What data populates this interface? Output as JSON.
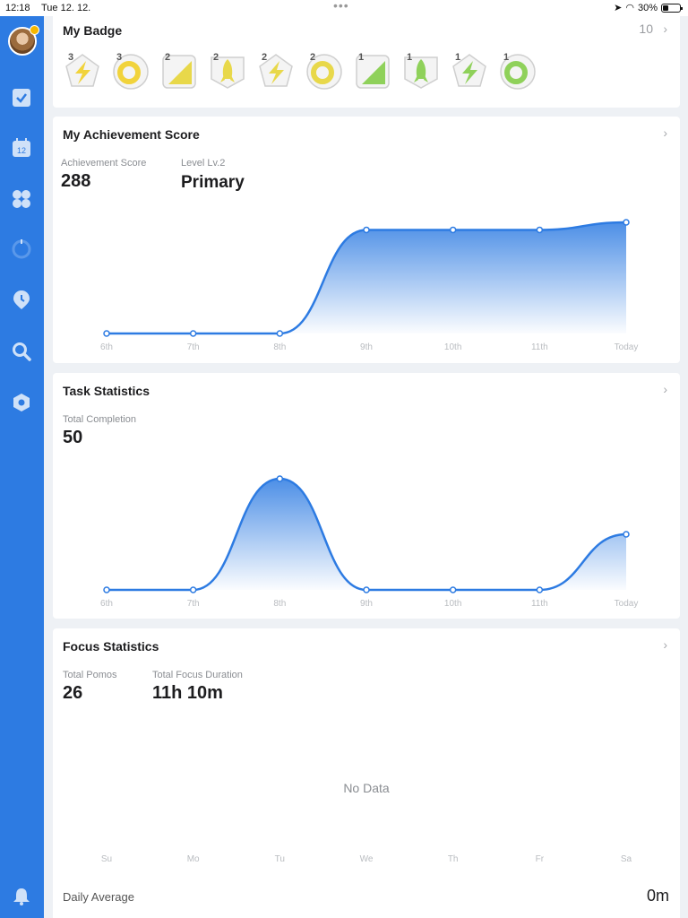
{
  "status_bar": {
    "time": "12:18",
    "date": "Tue 12. 12.",
    "battery": "30%"
  },
  "sidebar": {
    "items": [
      {
        "icon": "checkbox-icon"
      },
      {
        "icon": "calendar-icon",
        "label": "12"
      },
      {
        "icon": "grid-icon"
      },
      {
        "icon": "pomodoro-icon"
      },
      {
        "icon": "habit-icon"
      },
      {
        "icon": "search-icon"
      },
      {
        "icon": "settings-icon"
      },
      {
        "icon": "bell-icon"
      }
    ],
    "accent": "#2d7be2"
  },
  "badge_card": {
    "title": "My Badge",
    "count": "10",
    "badges": [
      {
        "level": "3",
        "icon": "lightning-badge-icon",
        "color": "#f1d33b"
      },
      {
        "level": "3",
        "icon": "spiral-badge-icon",
        "color": "#f1d33b"
      },
      {
        "level": "2",
        "icon": "triangle-badge-icon",
        "color": "#e8d84a"
      },
      {
        "level": "2",
        "icon": "rocket-badge-icon",
        "color": "#e8d84a"
      },
      {
        "level": "2",
        "icon": "lightning-badge-icon",
        "color": "#e8d84a"
      },
      {
        "level": "2",
        "icon": "spiral-badge-icon",
        "color": "#e8d84a"
      },
      {
        "level": "1",
        "icon": "triangle-badge-icon",
        "color": "#8fd15a"
      },
      {
        "level": "1",
        "icon": "rocket-badge-icon",
        "color": "#8fd15a"
      },
      {
        "level": "1",
        "icon": "lightning-badge-icon",
        "color": "#8fd15a"
      },
      {
        "level": "1",
        "icon": "spiral-badge-icon",
        "color": "#8fd15a"
      }
    ]
  },
  "achievement_card": {
    "title": "My Achievement Score",
    "score_label": "Achievement Score",
    "score_value": "288",
    "level_label": "Level Lv.2",
    "level_value": "Primary"
  },
  "task_card": {
    "title": "Task Statistics",
    "completion_label": "Total Completion",
    "completion_value": "50"
  },
  "focus_card": {
    "title": "Focus Statistics",
    "pomos_label": "Total Pomos",
    "pomos_value": "26",
    "duration_label": "Total Focus Duration",
    "duration_value": "11h 10m",
    "empty_text": "No Data",
    "days": [
      "Su",
      "Mo",
      "Tu",
      "We",
      "Th",
      "Fr",
      "Sa"
    ],
    "daily_average_label": "Daily Average",
    "daily_average_value": "0m"
  },
  "chart_data": [
    {
      "type": "area",
      "categories": [
        "6th",
        "7th",
        "8th",
        "9th",
        "10th",
        "11th",
        "Today"
      ],
      "values": [
        0,
        0,
        0,
        123,
        123,
        123,
        132
      ],
      "ylim": [
        0,
        132
      ],
      "color": "#2d7be2"
    },
    {
      "type": "area",
      "categories": [
        "6th",
        "7th",
        "8th",
        "9th",
        "10th",
        "11th",
        "Today"
      ],
      "values": [
        0,
        0,
        50,
        0,
        0,
        0,
        25
      ],
      "ylim": [
        0,
        50
      ],
      "color": "#2d7be2"
    }
  ]
}
